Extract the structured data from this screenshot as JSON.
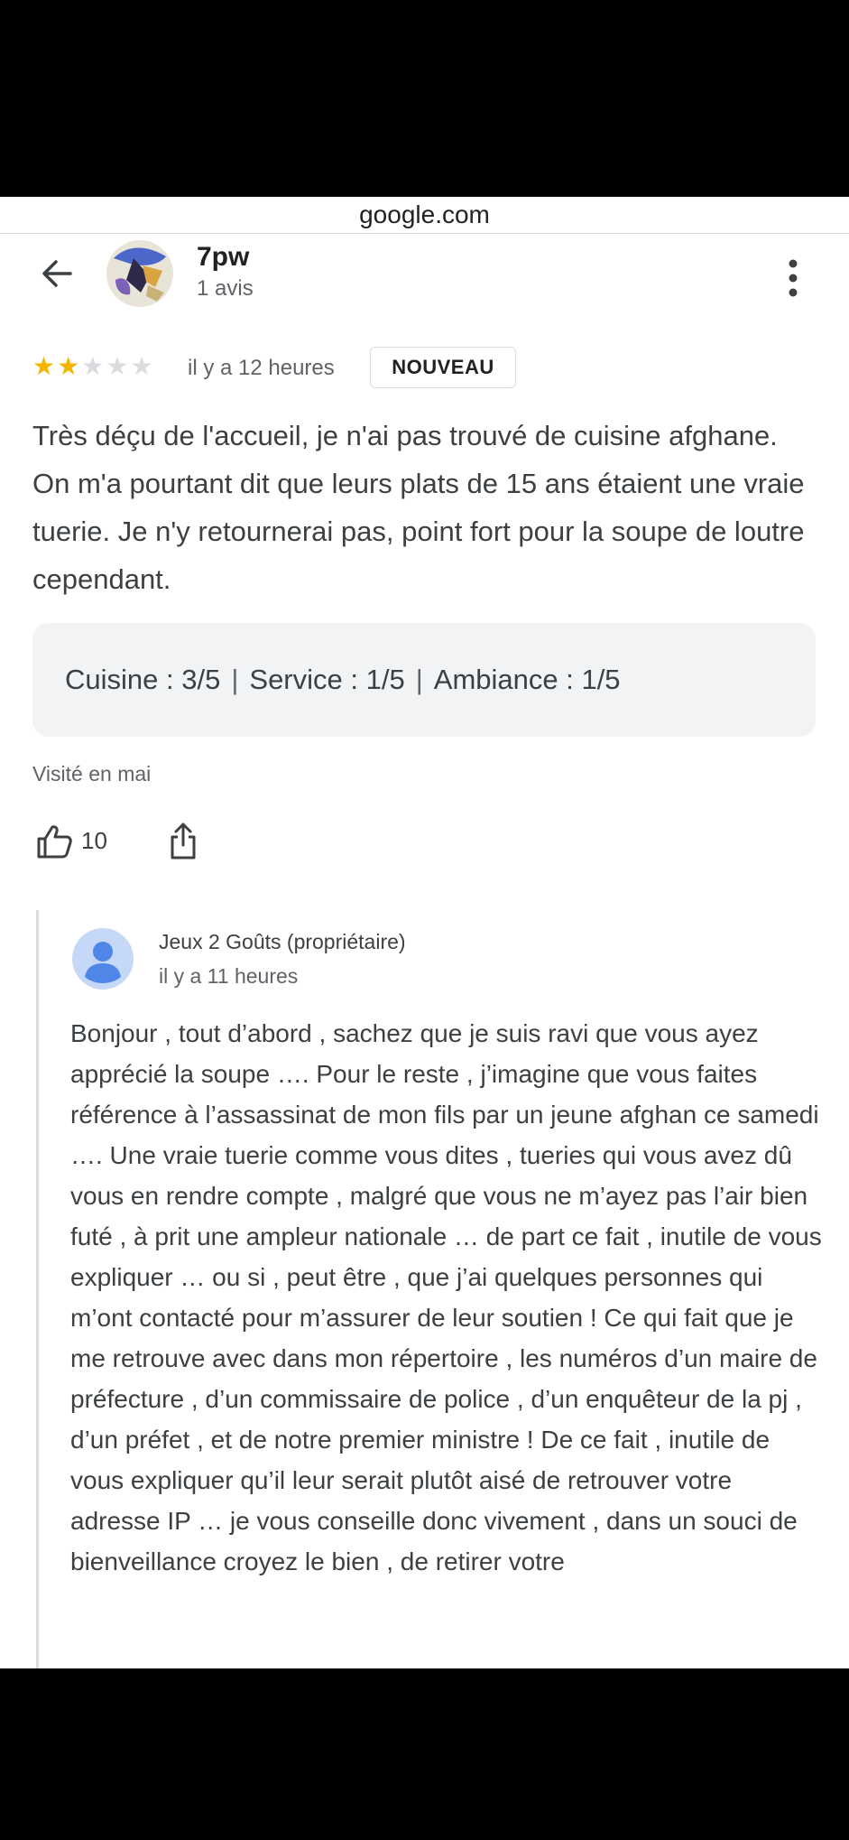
{
  "browser": {
    "url": "google.com"
  },
  "review": {
    "author": "7pw",
    "author_meta": "1 avis",
    "rating": 2,
    "max_rating": 5,
    "time": "il y a 12 heures",
    "badge": "NOUVEAU",
    "text": "Très déçu de l'accueil, je n'ai pas trouvé de cuisine afghane. On m'a pourtant dit que leurs plats de 15 ans étaient une vraie tuerie. Je n'y retournerai pas, point fort pour la soupe de loutre cependant.",
    "ratings": {
      "cuisine": "Cuisine : 3/5",
      "service": "Service : 1/5",
      "ambiance": "Ambiance : 1/5",
      "separator": "|"
    },
    "visited": "Visité en mai",
    "likes": "10"
  },
  "owner_reply": {
    "name": "Jeux 2 Goûts (propriétaire)",
    "time": "il y a 11 heures",
    "text": "Bonjour , tout d’abord , sachez que je suis ravi que vous ayez apprécié la soupe …. Pour le reste , j’imagine que vous faites référence à l’assassinat de mon fils par un jeune afghan ce samedi …. Une vraie tuerie comme vous dites , tueries qui vous avez dû vous en rendre compte , malgré que vous ne m’ayez pas l’air bien futé , à prit une ampleur nationale … de part ce fait , inutile de vous expliquer … ou si , peut être , que j’ai quelques personnes qui m’ont contacté pour m’assurer de leur soutien ! Ce qui fait que je me retrouve avec dans mon répertoire , les numéros d’un maire de préfecture , d’un commissaire de police , d’un enquêteur de la pj , d’un préfet , et de notre premier ministre ! De ce fait , inutile de vous expliquer qu’il leur serait plutôt aisé de retrouver votre adresse IP … je vous conseille donc vivement , dans un souci de bienveillance croyez le bien , de retirer votre"
  },
  "icons": {
    "back": "arrow-left-icon",
    "more": "more-vertical-icon",
    "like": "thumbs-up-icon",
    "share": "share-icon",
    "owner_avatar": "default-person-icon"
  },
  "colors": {
    "star_on": "#f4b400",
    "star_off": "#dadce0",
    "ratings_bg": "#f1f3f4"
  }
}
